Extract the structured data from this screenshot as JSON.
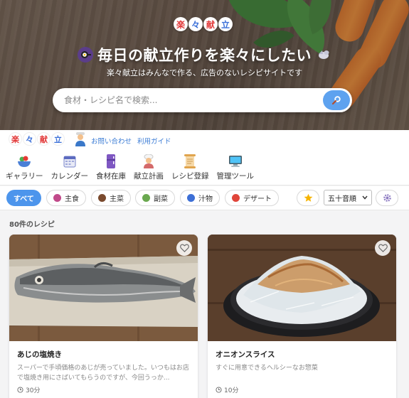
{
  "hero": {
    "logo_chars": [
      "楽",
      "々",
      "献",
      "立"
    ],
    "title": "毎日の献立作りを楽々にしたい",
    "subtitle": "楽々献立はみんなで作る、広告のないレシピサイトです",
    "search_placeholder": "食材・レシピ名で検索..."
  },
  "header": {
    "brand_chars": [
      "楽",
      "々",
      "献",
      "立"
    ],
    "links": [
      "お問い合わせ",
      "利用ガイド"
    ]
  },
  "nav": {
    "items": [
      {
        "label": "ギャラリー",
        "icon": "salad-bowl-icon"
      },
      {
        "label": "カレンダー",
        "icon": "calendar-icon"
      },
      {
        "label": "食材在庫",
        "icon": "fridge-icon"
      },
      {
        "label": "献立計画",
        "icon": "chef-icon"
      },
      {
        "label": "レシピ登録",
        "icon": "scroll-icon"
      },
      {
        "label": "管理ツール",
        "icon": "computer-icon"
      }
    ]
  },
  "filters": {
    "all": "すべて",
    "categories": [
      {
        "label": "主食",
        "color": "#c14a8a"
      },
      {
        "label": "主菜",
        "color": "#7a4a2e"
      },
      {
        "label": "副菜",
        "color": "#6aa84f"
      },
      {
        "label": "汁物",
        "color": "#3d6fd6"
      },
      {
        "label": "デザート",
        "color": "#e0453a"
      }
    ],
    "sort_selected": "五十音順"
  },
  "results": {
    "count_label": "80件のレシピ"
  },
  "recipes": [
    {
      "title": "あじの塩焼き",
      "description": "スーパーで手頃価格のあじが売っていました。いつもはお店で塩焼き用にさばいてもらうのですが、今回うっか...",
      "time": "30分"
    },
    {
      "title": "オニオンスライス",
      "description": "すぐに用意できるヘルシーなお惣菜",
      "time": "10分"
    }
  ],
  "colors": {
    "accent": "#4d95ec",
    "link": "#3a7bd5"
  }
}
